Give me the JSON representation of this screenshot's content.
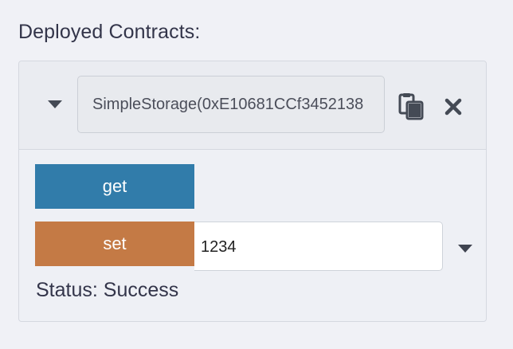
{
  "section": {
    "title": "Deployed Contracts:"
  },
  "contract": {
    "address_label": "SimpleStorage(0xE10681CCf3452138",
    "icons": {
      "expand": "caret-down-icon",
      "copy": "clipboard-copy-icon",
      "remove": "close-icon"
    }
  },
  "functions": {
    "get_label": "get",
    "set_label": "set",
    "set_value": "1234",
    "set_expand_icon": "caret-down-icon"
  },
  "status": {
    "text": "Status: Success"
  },
  "colors": {
    "get_button": "#317caa",
    "set_button": "#c47a45",
    "background": "#f0f1f6"
  }
}
